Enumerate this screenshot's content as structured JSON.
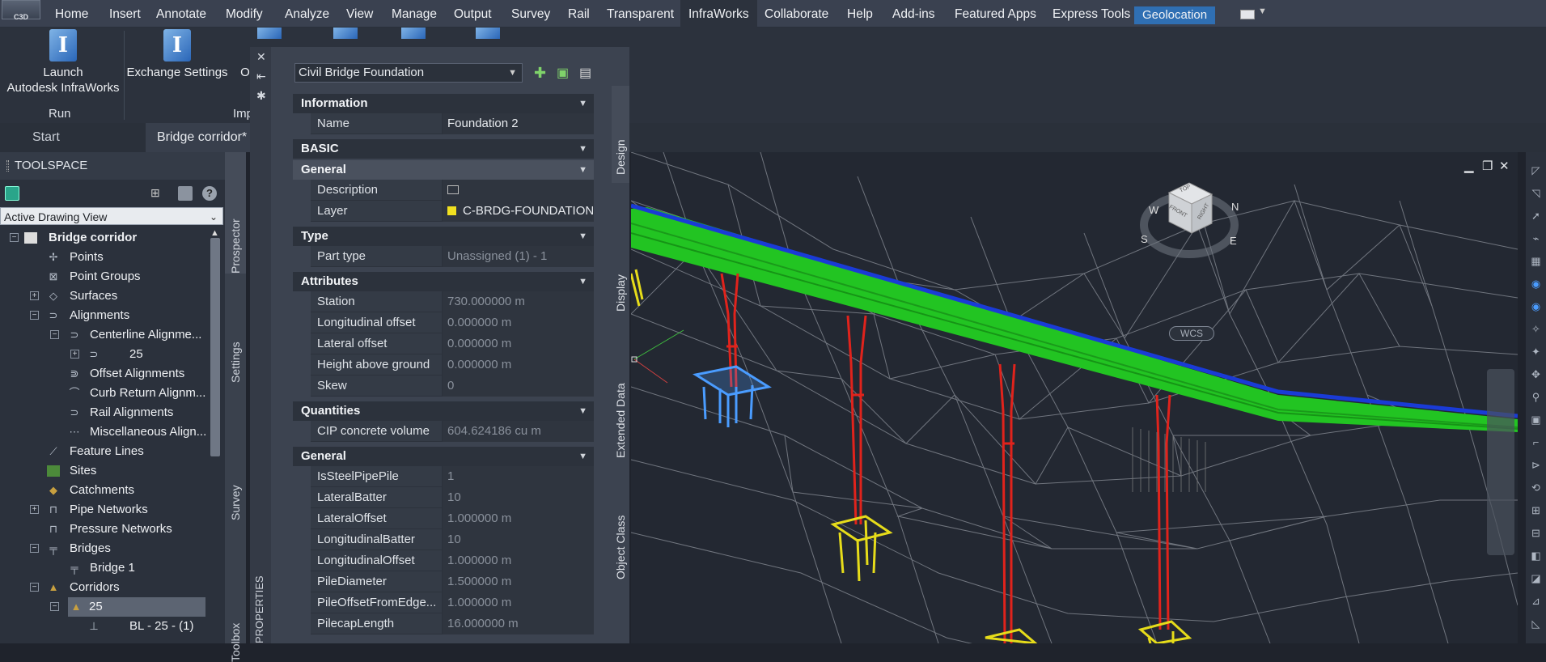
{
  "app": {
    "icon_label": "C3D"
  },
  "menu": {
    "items": [
      "Home",
      "Insert",
      "Annotate",
      "Modify",
      "Analyze",
      "View",
      "Manage",
      "Output",
      "Survey",
      "Rail",
      "Transparent",
      "InfraWorks",
      "Collaborate",
      "Help",
      "Add-ins",
      "Featured Apps",
      "Express Tools",
      "Geolocation"
    ],
    "active": "InfraWorks"
  },
  "ribbon": {
    "launch_label_line1": "Launch",
    "launch_label_line2": "Autodesk InfraWorks",
    "exchange_label": "Exchange Settings",
    "partial_label": "O",
    "group_run": "Run",
    "group_imp": "Imp"
  },
  "doc_tabs": {
    "start": "Start",
    "current": "Bridge corridor*"
  },
  "toolspace": {
    "title": "TOOLSPACE",
    "view_selector": "Active Drawing View",
    "tree": [
      {
        "label": "Bridge corridor",
        "bold": true
      },
      {
        "label": "Points"
      },
      {
        "label": "Point Groups"
      },
      {
        "label": "Surfaces"
      },
      {
        "label": "Alignments"
      },
      {
        "label": "Centerline Alignme..."
      },
      {
        "label": "25"
      },
      {
        "label": "Offset Alignments"
      },
      {
        "label": "Curb Return Alignm..."
      },
      {
        "label": "Rail Alignments"
      },
      {
        "label": "Miscellaneous Align..."
      },
      {
        "label": "Feature Lines"
      },
      {
        "label": "Sites"
      },
      {
        "label": "Catchments"
      },
      {
        "label": "Pipe Networks"
      },
      {
        "label": "Pressure Networks"
      },
      {
        "label": "Bridges"
      },
      {
        "label": "Bridge 1"
      },
      {
        "label": "Corridors"
      },
      {
        "label": "25"
      },
      {
        "label": "BL - 25 - (1)"
      }
    ],
    "side_tabs": [
      "Prospector",
      "Settings",
      "Survey",
      "Toolbox"
    ]
  },
  "properties": {
    "object_type": "Civil Bridge Foundation",
    "side_label": "PROPERTIES",
    "tabs": [
      "Design",
      "Display",
      "Extended Data",
      "Object Class"
    ],
    "sections": {
      "information": "Information",
      "basic": "BASIC",
      "general": "General",
      "type": "Type",
      "attributes": "Attributes",
      "quantities": "Quantities",
      "general2": "General"
    },
    "rows": {
      "name": {
        "label": "Name",
        "value": "Foundation 2"
      },
      "description": {
        "label": "Description"
      },
      "layer": {
        "label": "Layer",
        "value": "C-BRDG-FOUNDATION",
        "color": "#f0e020"
      },
      "part_type": {
        "label": "Part type",
        "value": "Unassigned (1) - 1"
      },
      "station": {
        "label": "Station",
        "value": "730.000000 m"
      },
      "long_offset": {
        "label": "Longitudinal offset",
        "value": "0.000000 m"
      },
      "lat_offset": {
        "label": "Lateral offset",
        "value": "0.000000 m"
      },
      "height": {
        "label": "Height above ground",
        "value": "0.000000 m"
      },
      "skew": {
        "label": "Skew",
        "value": "0"
      },
      "cip": {
        "label": "CIP concrete volume",
        "value": "604.624186  cu m"
      },
      "steel": {
        "label": "IsSteelPipePile",
        "value": "1"
      },
      "latbatter": {
        "label": "LateralBatter",
        "value": "10"
      },
      "latoffset": {
        "label": "LateralOffset",
        "value": "1.000000 m"
      },
      "longbatter": {
        "label": "LongitudinalBatter",
        "value": "10"
      },
      "longoffset": {
        "label": "LongitudinalOffset",
        "value": "1.000000 m"
      },
      "pilediam": {
        "label": "PileDiameter",
        "value": "1.500000 m"
      },
      "pileoffset": {
        "label": "PileOffsetFromEdge...",
        "value": "1.000000 m"
      },
      "pilecap": {
        "label": "PilecapLength",
        "value": "16.000000 m"
      }
    }
  },
  "viewport": {
    "viewcube_top": "TOP",
    "viewcube_front": "FRONT",
    "viewcube_right": "RIGHT",
    "compass_w": "W",
    "compass_s": "S",
    "compass_e": "E",
    "compass_n": "N",
    "wcs": "WCS"
  },
  "colors": {
    "deck": "#22c422",
    "deck_edge": "#1a3bd6",
    "pier": "#e0231c",
    "pile_selected": "#4a9cff",
    "pile": "#e6dc1a",
    "mesh": "#8a8f98",
    "geolocation_tab": "#2f6fb3"
  }
}
